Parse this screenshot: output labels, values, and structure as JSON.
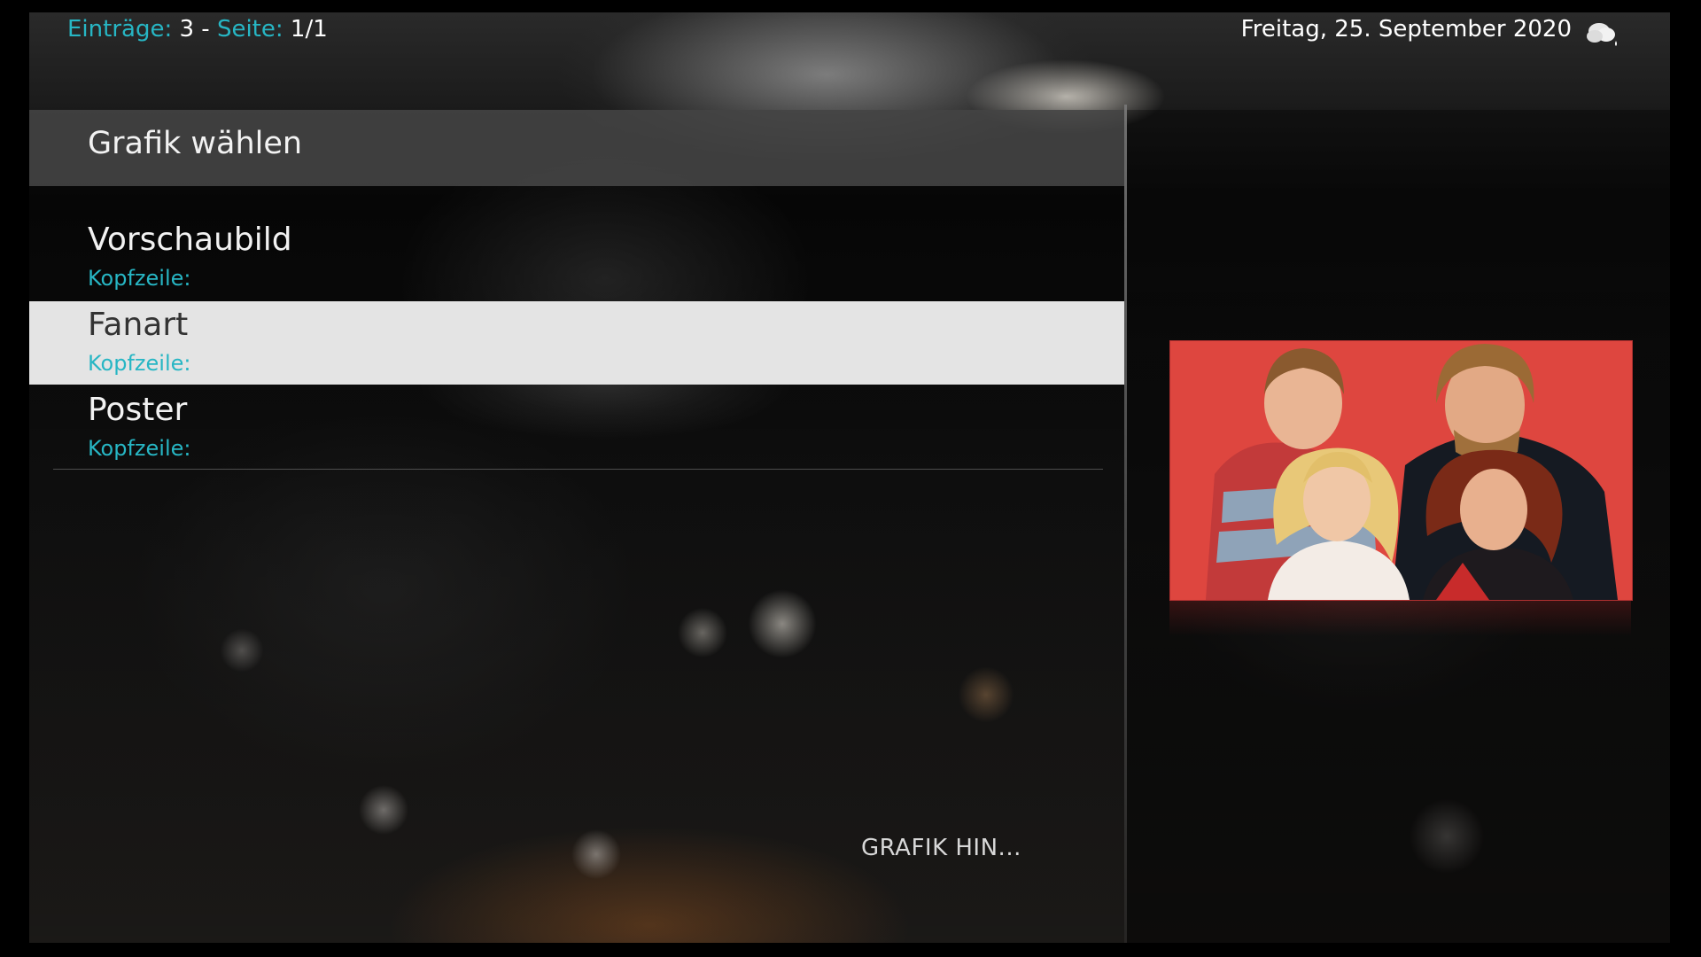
{
  "topbar": {
    "entries_label": "Einträge:",
    "entries_value": "3",
    "separator": "-",
    "page_label": "Seite:",
    "page_value": "1/1",
    "date": "Freitag, 25. September 2020",
    "weather_icon": "cloud-rain-icon"
  },
  "dialog": {
    "title": "Grafik wählen",
    "items": [
      {
        "title": "Vorschaubild",
        "subtitle": "Kopfzeile:"
      },
      {
        "title": "Fanart",
        "subtitle": "Kopfzeile:",
        "selected": true
      },
      {
        "title": "Poster",
        "subtitle": "Kopfzeile:"
      }
    ],
    "footer": "GRAFIK HIN..."
  },
  "preview": {
    "subject_icon": "band-photo-artwork",
    "background_color": "#e04a42"
  },
  "colors": {
    "accent": "#27b6c4",
    "selection": "#e4e4e4"
  }
}
